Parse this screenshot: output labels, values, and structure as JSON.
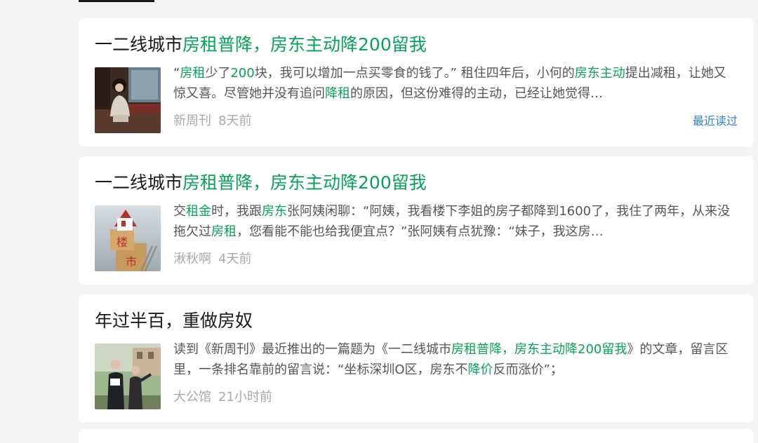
{
  "feed": {
    "items": [
      {
        "title_parts": [
          {
            "text": "一二线城市",
            "hl": false
          },
          {
            "text": "房租普降，房东主动降200留我",
            "hl": true
          }
        ],
        "summary_parts": [
          {
            "text": "“",
            "hl": false
          },
          {
            "text": "房租",
            "hl": true
          },
          {
            "text": "少了",
            "hl": false
          },
          {
            "text": "200",
            "hl": true
          },
          {
            "text": "块，我可以增加一点买零食的钱了。” 租住四年后，小何的",
            "hl": false
          },
          {
            "text": "房东主动",
            "hl": true
          },
          {
            "text": "提出减租，让她又惊又喜。尽管她并没有追问",
            "hl": false
          },
          {
            "text": "降租",
            "hl": true
          },
          {
            "text": "的原因，但这份难得的主动，已经让她觉得…",
            "hl": false
          }
        ],
        "source": "新周刊",
        "time": "8天前",
        "tag": "最近读过",
        "thumbnail_icon": "woman-sitting-room-photo"
      },
      {
        "title_parts": [
          {
            "text": "一二线城市",
            "hl": false
          },
          {
            "text": "房租普降，房东主动降200留我",
            "hl": true
          }
        ],
        "summary_parts": [
          {
            "text": "交",
            "hl": false
          },
          {
            "text": "租金",
            "hl": true
          },
          {
            "text": "时，我跟",
            "hl": false
          },
          {
            "text": "房东",
            "hl": true
          },
          {
            "text": "张阿姨闲聊：“阿姨，我看楼下李姐的房子都降到1600了，我住了两年，从来没拖欠过",
            "hl": false
          },
          {
            "text": "房租",
            "hl": true
          },
          {
            "text": "，您看能不能也给我便宜点？”张阿姨有点犹豫：“妹子，我这房…",
            "hl": false
          }
        ],
        "source": "湫秋啊",
        "time": "4天前",
        "tag": "",
        "thumbnail_icon": "house-market-blocks-photo",
        "thumbnail_text": [
          "楼",
          "市"
        ]
      },
      {
        "title_parts": [
          {
            "text": "年过半百，重做房奴",
            "hl": false
          }
        ],
        "summary_parts": [
          {
            "text": "读到《新周刊》最近推出的一篇题为《一二线城市",
            "hl": false
          },
          {
            "text": "房租普降，房东主动降200留我",
            "hl": true
          },
          {
            "text": "》的文章，留言区里，一条排名靠前的留言说：“坐标深圳",
            "hl": false
          },
          {
            "text": "O",
            "hl": false
          },
          {
            "text": "区，房东不",
            "hl": false
          },
          {
            "text": "降价",
            "hl": true
          },
          {
            "text": "反而涨价”；",
            "hl": false
          }
        ],
        "source": "大公馆",
        "time": "21小时前",
        "tag": "",
        "thumbnail_icon": "couple-real-estate-photo"
      }
    ]
  },
  "colors": {
    "highlight": "#07a35a",
    "title": "#1a1a1a",
    "summary": "#555555",
    "meta": "#a8a8a8",
    "tag": "#2a7ee0",
    "background": "#f4f4f4"
  }
}
